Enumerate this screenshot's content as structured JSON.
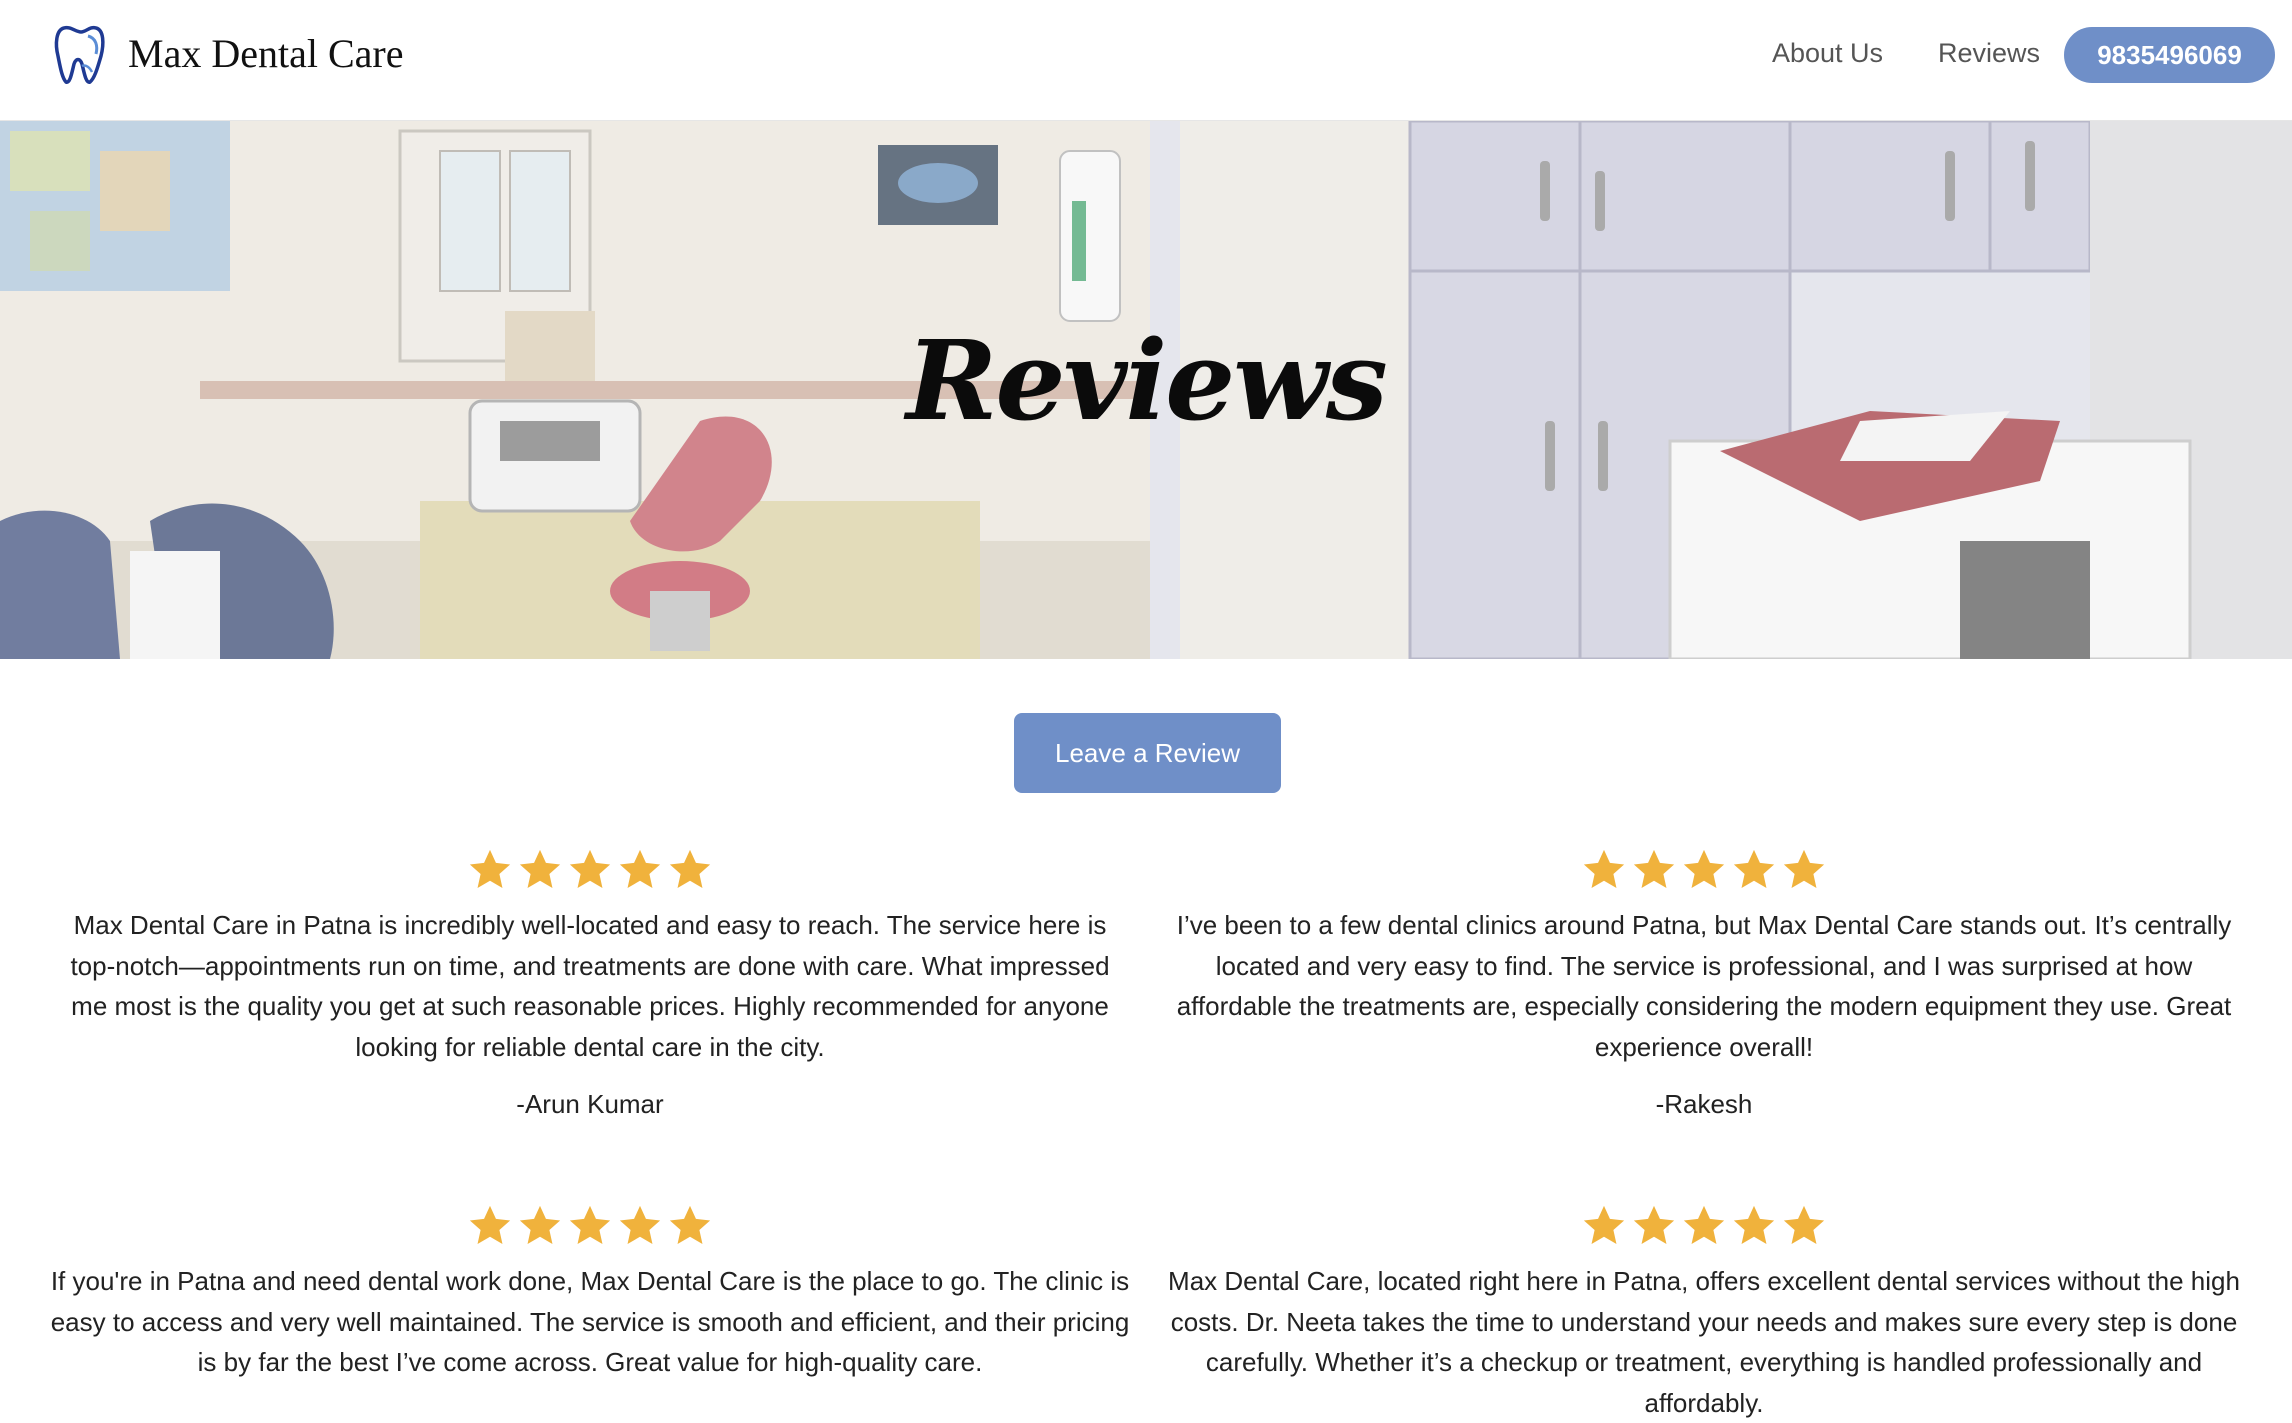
{
  "brand": {
    "name": "Max Dental Care",
    "logo_icon": "tooth-icon",
    "logo_color": "#1f3a93"
  },
  "nav": {
    "about": "About Us",
    "reviews": "Reviews",
    "phone": "9835496069"
  },
  "hero": {
    "title": "Reviews"
  },
  "actions": {
    "leave_review": "Leave a Review"
  },
  "colors": {
    "accent": "#6f8fc8",
    "star": "#f0b23c"
  },
  "reviews": [
    {
      "stars": 5,
      "text": "Max Dental Care in Patna is incredibly well-located and easy to reach. The service here is top-notch—appointments run on time, and treatments are done with care. What impressed me most is the quality you get at such reasonable prices. Highly recommended for anyone looking for reliable dental care in the city.",
      "author": "-Arun Kumar"
    },
    {
      "stars": 5,
      "text": "I’ve been to a few dental clinics around Patna, but Max Dental Care stands out. It’s centrally located and very easy to find. The service is professional, and I was surprised at how affordable the treatments are, especially considering the modern equipment they use. Great experience overall!",
      "author": "-Rakesh"
    },
    {
      "stars": 5,
      "text": "If you're in Patna and need dental work done, Max Dental Care is the place to go. The clinic is easy to access and very well maintained. The service is smooth and efficient, and their pricing is by far the best I’ve come across. Great value for high-quality care.",
      "author": ""
    },
    {
      "stars": 5,
      "text": "Max Dental Care, located right here in Patna, offers excellent dental services without the high costs. Dr. Neeta takes the time to understand your needs and makes sure every step is done carefully. Whether it’s a checkup or treatment, everything is handled professionally and affordably.",
      "author": ""
    }
  ]
}
